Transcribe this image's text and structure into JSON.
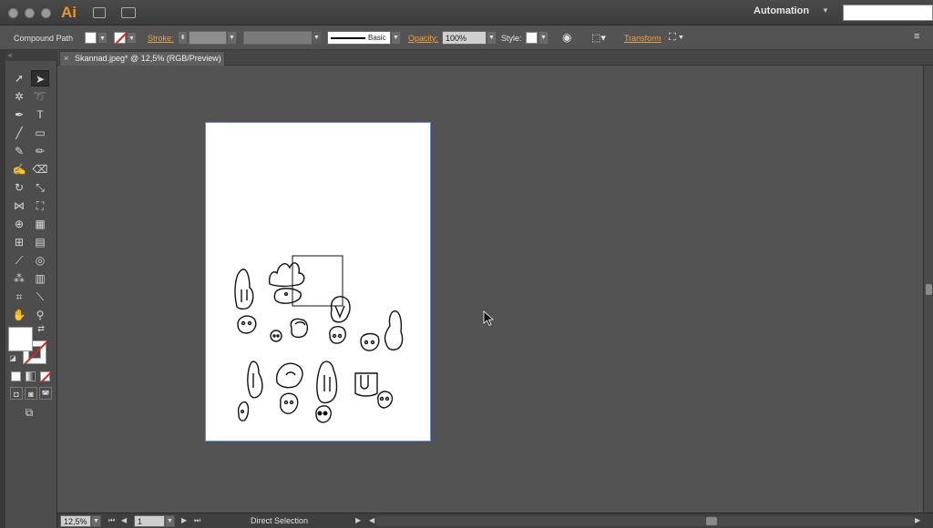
{
  "app": {
    "name": "Ai",
    "workspace": "Automation"
  },
  "control_bar": {
    "selection_type": "Compound Path",
    "stroke_label": "Stroke:",
    "brush_label": "Basic",
    "opacity_label": "Opacity:",
    "opacity_value": "100%",
    "style_label": "Style:",
    "transform_label": "Transform"
  },
  "document_tab": {
    "title": "Skannad.jpeg* @ 12,5% (RGB/Preview)",
    "close_glyph": "×"
  },
  "status_bar": {
    "zoom": "12,5%",
    "artboard": "1",
    "tool_status": "Direct Selection"
  },
  "colors": {
    "accent": "#e8952e",
    "link": "#f0a040",
    "artboard_border": "#6d8fd6"
  },
  "toolbox": {
    "collapse_glyph": "«"
  }
}
